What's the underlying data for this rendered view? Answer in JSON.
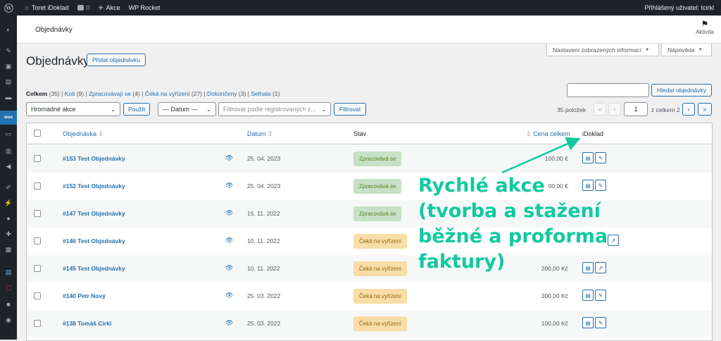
{
  "adminbar": {
    "site_name": "Toret iDoklad",
    "comments_count": "0",
    "new_label": "Akce",
    "rocket_label": "WP Rocket",
    "user_label": "Přihlášený uživatel: tcirkl"
  },
  "topbar": {
    "title": "Objednávky",
    "activity_label": "Aktivita"
  },
  "screen_options": {
    "display_settings": "Nastavení zobrazených informací",
    "help": "Nápověda"
  },
  "page": {
    "title": "Objednávky",
    "add_button": "Přidat objednávku"
  },
  "filters": {
    "all": "Celkem",
    "all_count": "(35)",
    "trash": "Koš",
    "trash_count": "(9)",
    "processing": "Zpracovávají se",
    "processing_count": "(4)",
    "on_hold": "Čeká na vyřízení",
    "on_hold_count": "(27)",
    "completed": "Dokončeny",
    "completed_count": "(3)",
    "failed": "Selhala",
    "failed_count": "(1)"
  },
  "search": {
    "button": "Hledat objednávky"
  },
  "bulk": {
    "selected": "Hromadné akce",
    "apply": "Použít",
    "date_selected": "— Datum —",
    "customer_placeholder": "Filtrovat podle registrovaných z...",
    "filter": "Filtrovat"
  },
  "pagination": {
    "items": "35 položek",
    "first": "«",
    "prev": "‹",
    "current": "1",
    "of_total": "z celkem 2",
    "next": "›",
    "last": "»"
  },
  "columns": {
    "order": "Objednávka",
    "date": "Datum",
    "status": "Stav",
    "total": "Cena celkem",
    "idoklad": "iDoklad"
  },
  "orders": [
    {
      "name": "#153 Test Objednávky",
      "date": "25. 04. 2023",
      "status": "Zpracovává se",
      "total": "100,00 €"
    },
    {
      "name": "#152 Test Objednávky",
      "date": "25. 04. 2023",
      "status": "Zpracovává se",
      "total": "00,00 €"
    },
    {
      "name": "#147 Test Objednávky",
      "date": "15. 11. 2022",
      "status": "Zpracovává se",
      "total": ""
    },
    {
      "name": "#146 Test Objednávky",
      "date": "10. 11. 2022",
      "status": "Čeká na vyřízení",
      "total": ""
    },
    {
      "name": "#145 Test Objednávky",
      "date": "10. 11. 2022",
      "status": "Čeká na vyřízení",
      "total": "200,00 Kč"
    },
    {
      "name": "#140 Petr Nový",
      "date": "25. 03. 2022",
      "status": "Čeká na vyřízení",
      "total": "300,00 Kč"
    },
    {
      "name": "#138 Tomáš Cirkl",
      "date": "25. 03. 2022",
      "status": "Čeká na vyřízení",
      "total": "100,00 Kč"
    }
  ],
  "annotation": {
    "line1": "Rychlé akce",
    "line2": "(tvorba a stažení",
    "line3": "běžné a proforma",
    "line4": "faktury)"
  },
  "colors": {
    "accent": "#2271b1",
    "annotation": "#10c9a0",
    "processing_bg": "#c6e1c6",
    "on_hold_bg": "#f8dda7"
  }
}
